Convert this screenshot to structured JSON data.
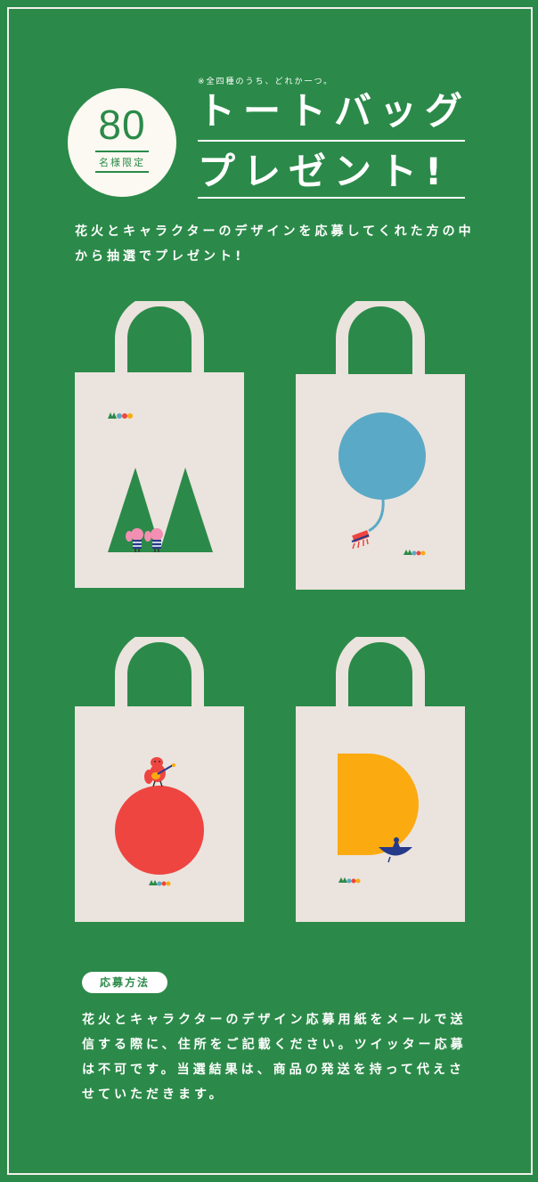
{
  "note": "※全四種のうち、どれか一つ。",
  "badge": {
    "number": "80",
    "limit": "名様限定"
  },
  "title": {
    "line1": "トートバッグ",
    "line2": "プレゼント!"
  },
  "intro": "花火とキャラクターのデザインを応募してくれた方の中から抽選でプレゼント!",
  "bags": [
    {
      "design": "mountains-icon"
    },
    {
      "design": "balloon-icon"
    },
    {
      "design": "red-ball-icon"
    },
    {
      "design": "yellow-d-icon"
    }
  ],
  "howto": {
    "label": "応募方法",
    "text": "花火とキャラクターのデザイン応募用紙をメールで送信する際に、住所をご記載ください。ツイッター応募は不可です。当選結果は、商品の発送を持って代えさせていただきます。"
  },
  "colors": {
    "green": "#2b8a49",
    "canvas": "#ebe3dd",
    "blue": "#5aa9c6",
    "red": "#ee4540",
    "yellow": "#fbaa10",
    "navy": "#263a8a"
  }
}
